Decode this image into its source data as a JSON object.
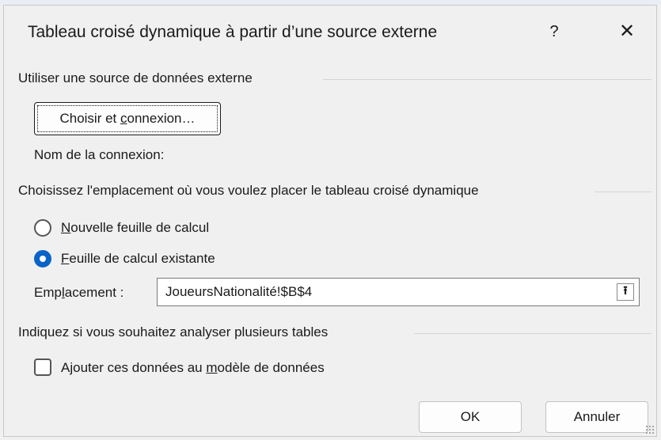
{
  "dialog": {
    "title": "Tableau croisé dynamique à partir d’une source externe",
    "help_glyph": "?",
    "close_glyph": "✕"
  },
  "source": {
    "heading": "Utiliser une source de données externe",
    "choose_button": {
      "before": "Choisir et ",
      "mnemonic": "c",
      "after": "onnexion…"
    },
    "connection_name_label": "Nom de la connexion:"
  },
  "placement": {
    "heading": "Choisissez l'emplacement où vous voulez placer le tableau croisé dynamique",
    "options": [
      {
        "mnemonic": "N",
        "rest": "ouvelle feuille de calcul",
        "selected": false
      },
      {
        "mnemonic": "F",
        "rest": "euille de calcul existante",
        "selected": true
      }
    ],
    "location_label": {
      "before": "Emp",
      "mnemonic": "l",
      "after": "acement :"
    },
    "location_value": "JoueursNationalité!$B$4",
    "collapse_glyph": "⭱"
  },
  "analysis": {
    "heading": "Indiquez si vous souhaitez analyser plusieurs tables",
    "checkbox": {
      "before": "Ajouter ces données au ",
      "mnemonic": "m",
      "after": "odèle de données",
      "checked": false
    }
  },
  "buttons": {
    "ok": "OK",
    "cancel": "Annuler"
  },
  "colors": {
    "accent": "#0a64c8",
    "background": "#f0f0f0"
  }
}
